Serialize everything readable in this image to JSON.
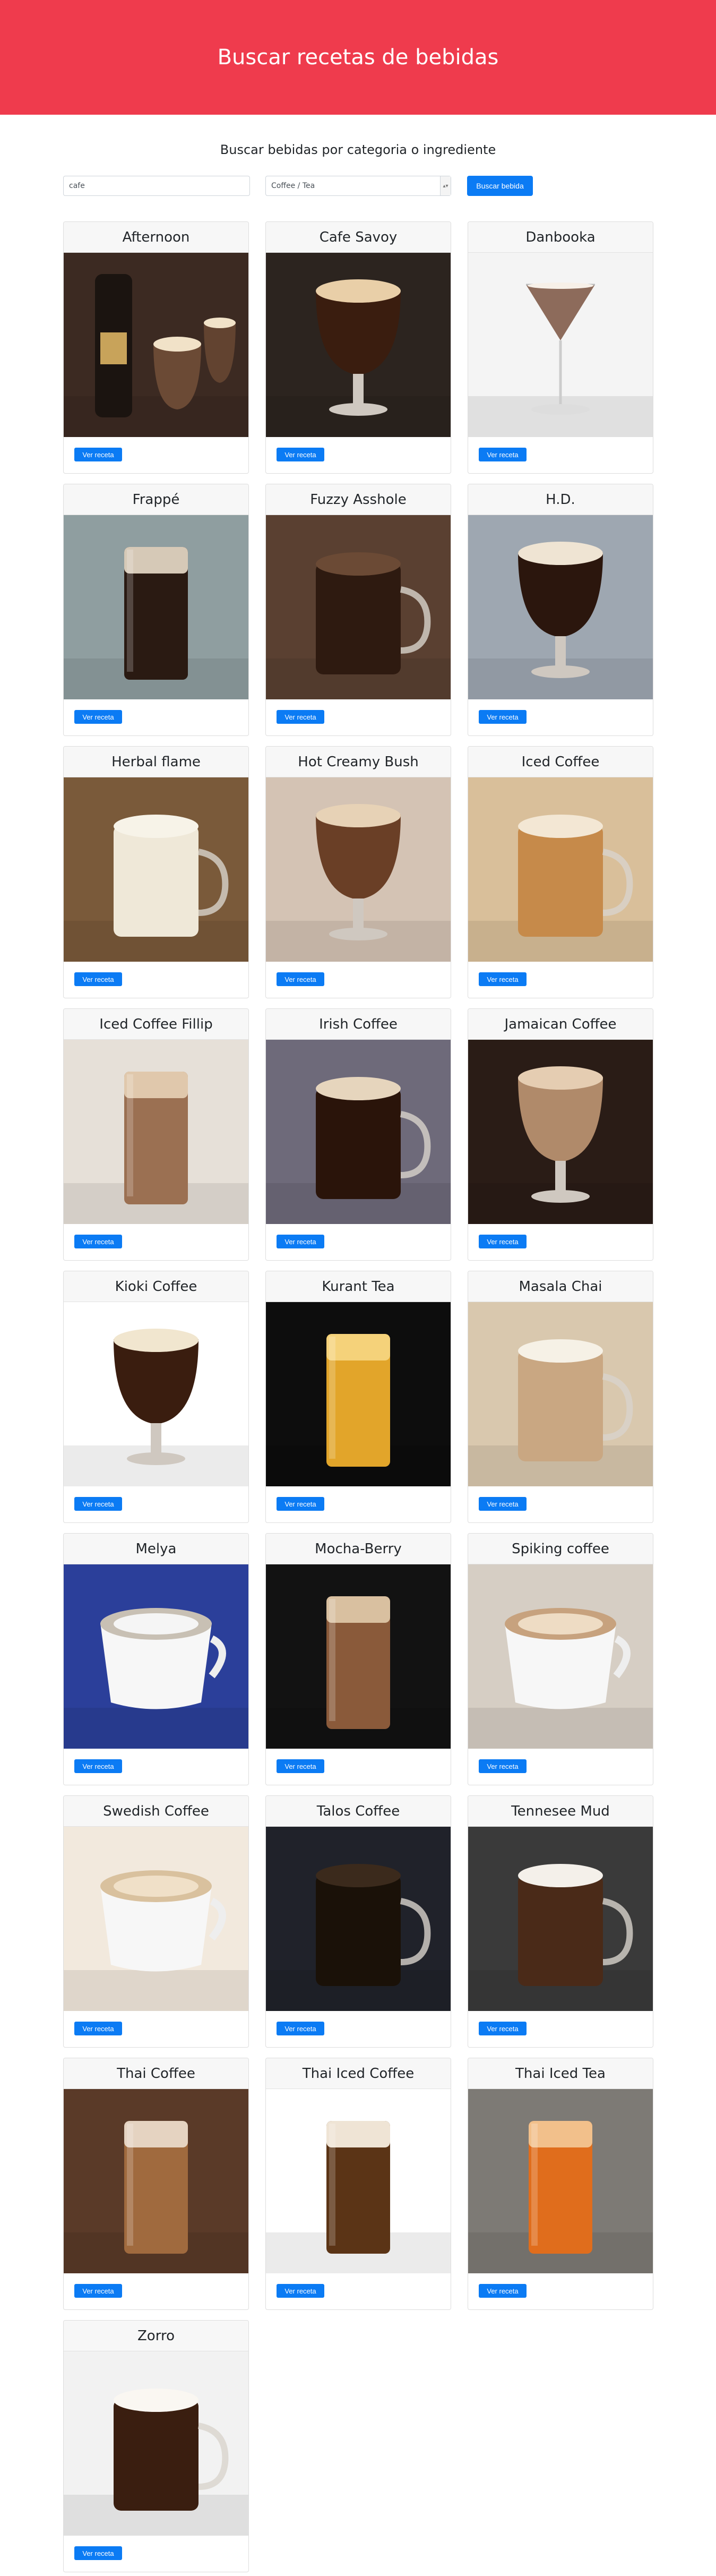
{
  "header": {
    "title": "Buscar recetas de bebidas"
  },
  "search": {
    "heading": "Buscar bebidas por categoria o ingrediente",
    "ingredient_value": "cafe",
    "category_selected": "Coffee / Tea",
    "button_label": "Buscar bebida"
  },
  "colors": {
    "hero": "#ef3b4d",
    "button": "#0b7bf4"
  },
  "drinks": [
    {
      "name": "Afternoon",
      "button": "Ver receta",
      "bg": "#3c2a22",
      "drink": "#6b4a35",
      "top": "#f1e2c8",
      "glass": "bottle"
    },
    {
      "name": "Cafe Savoy",
      "button": "Ver receta",
      "bg": "#2c241f",
      "drink": "#3a1d0f",
      "top": "#e9cfa8",
      "glass": "goblet"
    },
    {
      "name": "Danbooka",
      "button": "Ver receta",
      "bg": "#f4f4f4",
      "drink": "#7a5240",
      "top": "#f7f0e8",
      "glass": "martini"
    },
    {
      "name": "Frappé",
      "button": "Ver receta",
      "bg": "#8f9ea0",
      "drink": "#2a1a12",
      "top": "#d6c9b7",
      "glass": "tall"
    },
    {
      "name": "Fuzzy Asshole",
      "button": "Ver receta",
      "bg": "#5a4031",
      "drink": "#2e1a10",
      "top": "#6b4a35",
      "glass": "mug"
    },
    {
      "name": "H.D.",
      "button": "Ver receta",
      "bg": "#9ea7b1",
      "drink": "#2b160d",
      "top": "#efe4d3",
      "glass": "goblet"
    },
    {
      "name": "Herbal flame",
      "button": "Ver receta",
      "bg": "#7a5a3a",
      "drink": "#efe8d8",
      "top": "#f7f3e8",
      "glass": "mug"
    },
    {
      "name": "Hot Creamy Bush",
      "button": "Ver receta",
      "bg": "#d4c3b4",
      "drink": "#6a3f26",
      "top": "#e7d2b6",
      "glass": "goblet"
    },
    {
      "name": "Iced Coffee",
      "button": "Ver receta",
      "bg": "#d9bf9a",
      "drink": "#c68a4a",
      "top": "#f3e7d4",
      "glass": "mug"
    },
    {
      "name": "Iced Coffee Fillip",
      "button": "Ver receta",
      "bg": "#e6e0d8",
      "drink": "#9b7052",
      "top": "#e0c8ac",
      "glass": "tall"
    },
    {
      "name": "Irish Coffee",
      "button": "Ver receta",
      "bg": "#6e6a7a",
      "drink": "#2a140a",
      "top": "#e6d5bd",
      "glass": "mug"
    },
    {
      "name": "Jamaican Coffee",
      "button": "Ver receta",
      "bg": "#2a1c16",
      "drink": "#b08a6a",
      "top": "#e5cdb2",
      "glass": "goblet"
    },
    {
      "name": "Kioki Coffee",
      "button": "Ver receta",
      "bg": "#ffffff",
      "drink": "#3a1d0f",
      "top": "#f1e6cf",
      "glass": "goblet"
    },
    {
      "name": "Kurant Tea",
      "button": "Ver receta",
      "bg": "#0d0d0d",
      "drink": "#e2a52a",
      "top": "#f5d27a",
      "glass": "tall"
    },
    {
      "name": "Masala Chai",
      "button": "Ver receta",
      "bg": "#d9c8ae",
      "drink": "#c9a782",
      "top": "#f6f1e6",
      "glass": "mug"
    },
    {
      "name": "Melya",
      "button": "Ver receta",
      "bg": "#2b3f9a",
      "drink": "#c8c0b4",
      "top": "#f5f5f5",
      "glass": "cup"
    },
    {
      "name": "Mocha-Berry",
      "button": "Ver receta",
      "bg": "#121212",
      "drink": "#8a5a3a",
      "top": "#d9c0a0",
      "glass": "tall"
    },
    {
      "name": "Spiking coffee",
      "button": "Ver receta",
      "bg": "#d6cec4",
      "drink": "#c7a27e",
      "top": "#eedcc4",
      "glass": "cup"
    },
    {
      "name": "Swedish Coffee",
      "button": "Ver receta",
      "bg": "#f2e9dd",
      "drink": "#d9c19e",
      "top": "#f0e0c8",
      "glass": "cup"
    },
    {
      "name": "Talos Coffee",
      "button": "Ver receta",
      "bg": "#20222a",
      "drink": "#1a1108",
      "top": "#3b2a1c",
      "glass": "mug"
    },
    {
      "name": "Tennesee Mud",
      "button": "Ver receta",
      "bg": "#3a3a3a",
      "drink": "#4a2a18",
      "top": "#f4f0ea",
      "glass": "mug"
    },
    {
      "name": "Thai Coffee",
      "button": "Ver receta",
      "bg": "#5a3a28",
      "drink": "#a06a3e",
      "top": "#e5d3c1",
      "glass": "tall"
    },
    {
      "name": "Thai Iced Coffee",
      "button": "Ver receta",
      "bg": "#ffffff",
      "drink": "#5b3416",
      "top": "#efe4d5",
      "glass": "tall"
    },
    {
      "name": "Thai Iced Tea",
      "button": "Ver receta",
      "bg": "#7d7a75",
      "drink": "#e06d1c",
      "top": "#f2c08b",
      "glass": "tall"
    },
    {
      "name": "Zorro",
      "button": "Ver receta",
      "bg": "#f2f2f2",
      "drink": "#3a1e10",
      "top": "#faf7f2",
      "glass": "mug"
    }
  ]
}
